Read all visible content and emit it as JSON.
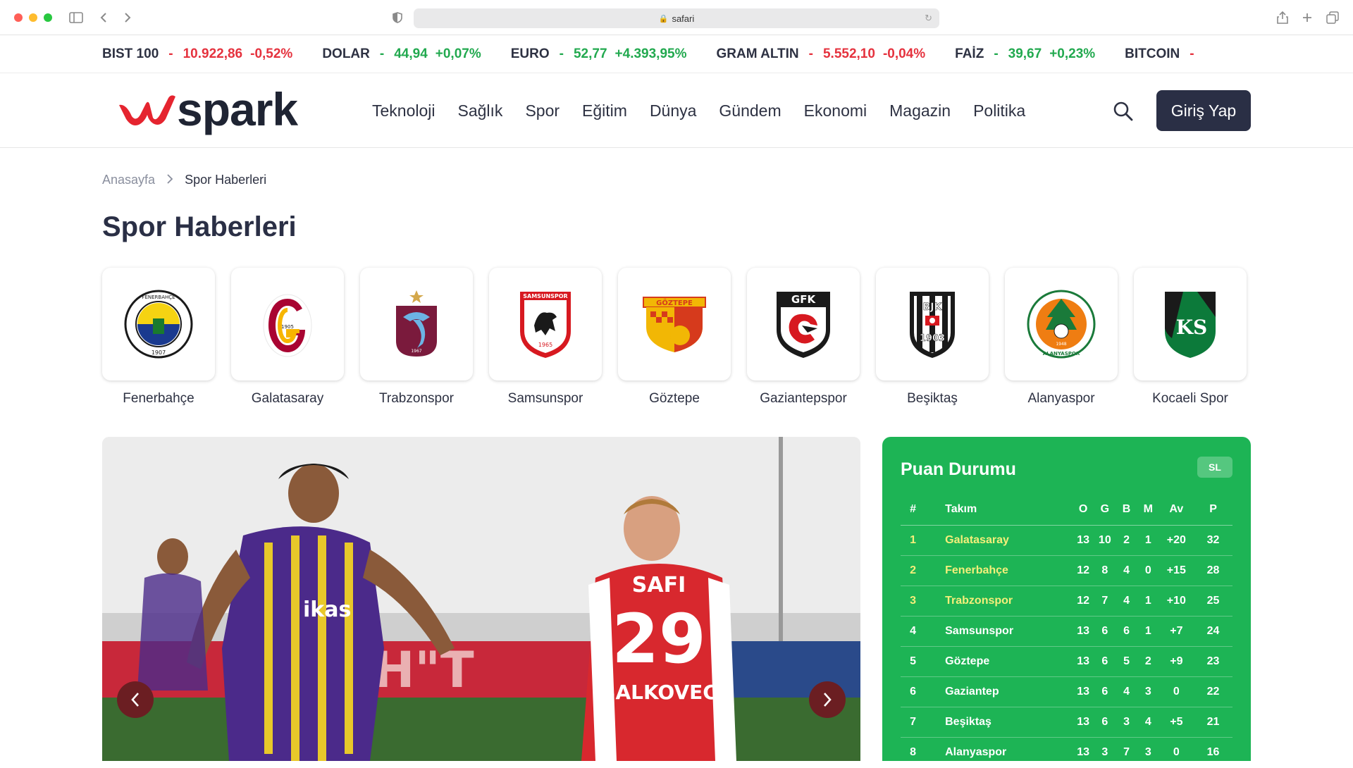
{
  "browser": {
    "url": "safari"
  },
  "ticker": [
    {
      "name": "BIST 100",
      "value": "10.922,86",
      "change": "-0,52%",
      "dir": "down"
    },
    {
      "name": "DOLAR",
      "value": "44,94",
      "change": "+0,07%",
      "dir": "up"
    },
    {
      "name": "EURO",
      "value": "52,77",
      "change": "+4.393,95%",
      "dir": "up"
    },
    {
      "name": "GRAM ALTIN",
      "value": "5.552,10",
      "change": "-0,04%",
      "dir": "down"
    },
    {
      "name": "FAİZ",
      "value": "39,67",
      "change": "+0,23%",
      "dir": "up"
    },
    {
      "name": "BITCOIN",
      "value": "",
      "change": "",
      "dir": "down"
    }
  ],
  "header": {
    "logo_text": "spark",
    "nav": [
      "Teknoloji",
      "Sağlık",
      "Spor",
      "Eğitim",
      "Dünya",
      "Gündem",
      "Ekonomi",
      "Magazin",
      "Politika"
    ],
    "login_label": "Giriş Yap"
  },
  "breadcrumb": {
    "home": "Anasayfa",
    "current": "Spor Haberleri"
  },
  "page_title": "Spor Haberleri",
  "teams": [
    {
      "name": "Fenerbahçe",
      "logo": "fenerbahce-logo"
    },
    {
      "name": "Galatasaray",
      "logo": "galatasaray-logo"
    },
    {
      "name": "Trabzonspor",
      "logo": "trabzonspor-logo"
    },
    {
      "name": "Samsunspor",
      "logo": "samsunspor-logo"
    },
    {
      "name": "Göztepe",
      "logo": "goztepe-logo"
    },
    {
      "name": "Gaziantepspor",
      "logo": "gaziantepspor-logo"
    },
    {
      "name": "Beşiktaş",
      "logo": "besiktas-logo"
    },
    {
      "name": "Alanyaspor",
      "logo": "alanyaspor-logo"
    },
    {
      "name": "Kocaeli Spor",
      "logo": "kocaelispor-logo"
    }
  ],
  "logo_lettering": {
    "fenerbahce": "FENERBAHÇE SPOR KULÜBÜ 1907",
    "galatasaray": "1905",
    "trabzonspor": "1967",
    "samsunspor": "SAMSUNSPOR 1965",
    "goztepe": "GÖZTEPE",
    "gaziantepspor": "GFK",
    "besiktas": "BJK 1903",
    "alanyaspor": "ALANYASPOR 1948"
  },
  "standings": {
    "title": "Puan Durumu",
    "badge": "SL",
    "columns": [
      "#",
      "Takım",
      "O",
      "G",
      "B",
      "M",
      "Av",
      "P"
    ],
    "rows": [
      [
        "1",
        "Galatasaray",
        "13",
        "10",
        "2",
        "1",
        "+20",
        "32"
      ],
      [
        "2",
        "Fenerbahçe",
        "12",
        "8",
        "4",
        "0",
        "+15",
        "28"
      ],
      [
        "3",
        "Trabzonspor",
        "12",
        "7",
        "4",
        "1",
        "+10",
        "25"
      ],
      [
        "4",
        "Samsunspor",
        "13",
        "6",
        "6",
        "1",
        "+7",
        "24"
      ],
      [
        "5",
        "Göztepe",
        "13",
        "6",
        "5",
        "2",
        "+9",
        "23"
      ],
      [
        "6",
        "Gaziantep",
        "13",
        "6",
        "4",
        "3",
        "0",
        "22"
      ],
      [
        "7",
        "Beşiktaş",
        "13",
        "6",
        "3",
        "4",
        "+5",
        "21"
      ],
      [
        "8",
        "Alanyaspor",
        "13",
        "3",
        "7",
        "3",
        "0",
        "16"
      ]
    ],
    "highlighted": 3
  },
  "hero": {
    "jersey_text": "SAFI",
    "jersey_number": "29",
    "player_name": "BALKOVEC",
    "sponsor": "ikas"
  },
  "colors": {
    "accent_red": "#e5323e",
    "accent_green": "#22a94f",
    "standings_bg": "#1db455",
    "login_bg": "#2a2f45",
    "carousel_arrow": "#6b1e22"
  }
}
